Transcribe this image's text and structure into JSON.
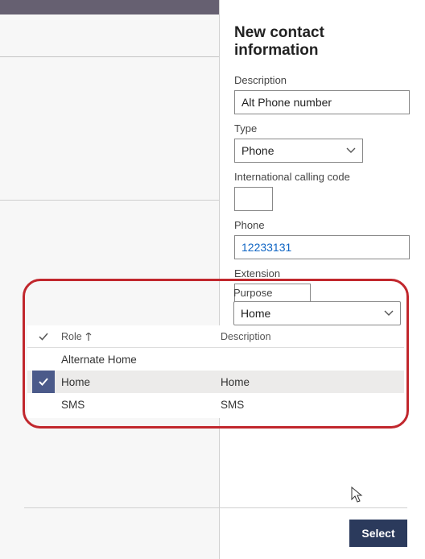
{
  "form": {
    "title": "New contact information",
    "fields": {
      "description": {
        "label": "Description",
        "value": "Alt Phone number"
      },
      "type": {
        "label": "Type",
        "value": "Phone"
      },
      "intl_code": {
        "label": "International calling code",
        "value": ""
      },
      "phone": {
        "label": "Phone",
        "value": "12233131"
      },
      "extension": {
        "label": "Extension",
        "value": ""
      },
      "purpose": {
        "label": "Purpose",
        "value": "Home"
      }
    }
  },
  "lookup": {
    "columns": {
      "role": "Role",
      "description": "Description"
    },
    "rows": [
      {
        "role": "Alternate Home",
        "description": "",
        "selected": false
      },
      {
        "role": "Home",
        "description": "Home",
        "selected": true
      },
      {
        "role": "SMS",
        "description": "SMS",
        "selected": false
      }
    ]
  },
  "footer": {
    "select_label": "Select"
  }
}
